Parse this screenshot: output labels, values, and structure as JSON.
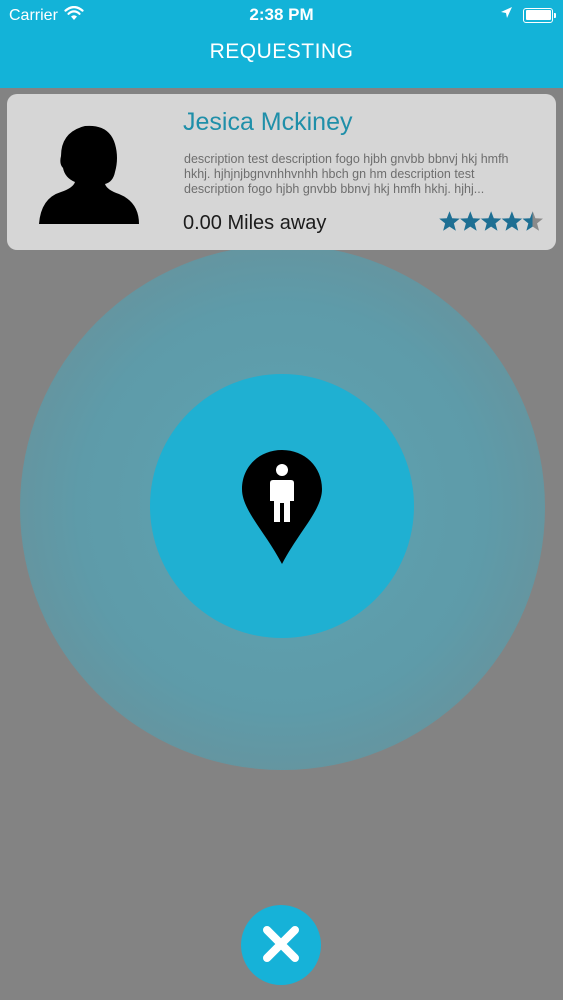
{
  "status_bar": {
    "carrier": "Carrier",
    "time": "2:38 PM"
  },
  "nav": {
    "title": "REQUESTING"
  },
  "driver": {
    "name": "Jesica Mckiney",
    "description": "description test description fogo hjbh gnvbb bbnvj hkj hmfh hkhj. hjhjnjbgnvnhhvnhh hbch gn hm description test description fogo hjbh gnvbb bbnvj hkj hmfh hkhj. hjhj...",
    "distance": "0.00 Miles away",
    "rating": 4.5,
    "rating_max": 5
  },
  "icons": {
    "wifi": "wifi-icon",
    "location_arrow": "location-arrow-icon",
    "battery": "battery-icon",
    "avatar": "person-silhouette-icon",
    "pin": "person-map-pin-icon",
    "cancel": "close-icon",
    "star": "star-icon"
  },
  "colors": {
    "header": "#13b3d8",
    "accent": "#1f8fa9",
    "star": "#1e6f93",
    "star_empty": "#8a8a8a",
    "pulse_inner": "#1fb0d2",
    "pulse_outer": "#5e9ba9",
    "background": "#838383",
    "card": "#d6d6d6"
  }
}
